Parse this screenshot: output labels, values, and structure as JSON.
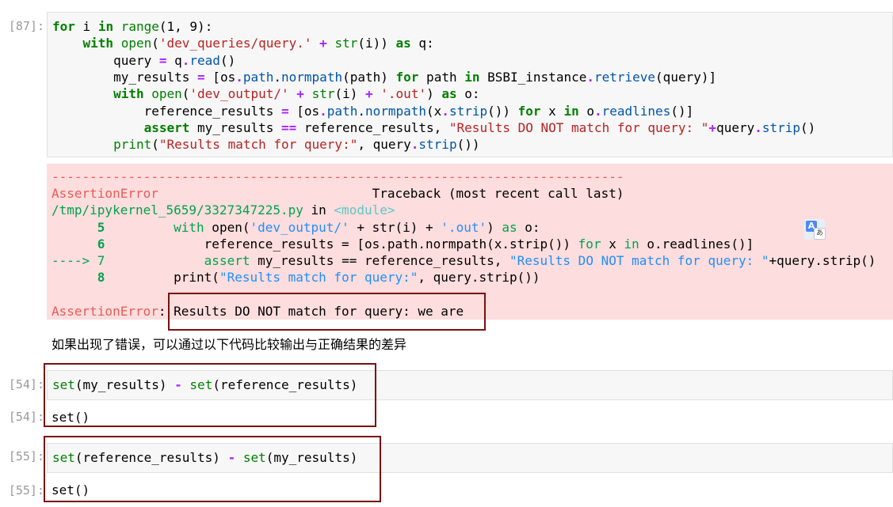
{
  "cells": [
    {
      "prompt": "[87]:",
      "code": [
        [
          {
            "t": "for",
            "c": "kw"
          },
          {
            "t": " i "
          },
          {
            "t": "in",
            "c": "kw"
          },
          {
            "t": " "
          },
          {
            "t": "range",
            "c": "fn"
          },
          {
            "t": "(1, 9):"
          }
        ],
        [
          {
            "t": "    "
          },
          {
            "t": "with",
            "c": "kw"
          },
          {
            "t": " "
          },
          {
            "t": "open",
            "c": "fn"
          },
          {
            "t": "("
          },
          {
            "t": "'dev_queries/query.'",
            "c": "str"
          },
          {
            "t": " "
          },
          {
            "t": "+",
            "c": "op"
          },
          {
            "t": " "
          },
          {
            "t": "str",
            "c": "fn"
          },
          {
            "t": "(i)) "
          },
          {
            "t": "as",
            "c": "kw"
          },
          {
            "t": " q:"
          }
        ],
        [
          {
            "t": "        query "
          },
          {
            "t": "=",
            "c": "op"
          },
          {
            "t": " q"
          },
          {
            "t": ".",
            "c": "op"
          },
          {
            "t": "read",
            "c": "attr"
          },
          {
            "t": "()"
          }
        ],
        [
          {
            "t": "        my_results "
          },
          {
            "t": "=",
            "c": "op"
          },
          {
            "t": " [os"
          },
          {
            "t": ".",
            "c": "op"
          },
          {
            "t": "path",
            "c": "attr"
          },
          {
            "t": "."
          },
          {
            "t": "normpath",
            "c": "attr"
          },
          {
            "t": "(path) "
          },
          {
            "t": "for",
            "c": "kw"
          },
          {
            "t": " path "
          },
          {
            "t": "in",
            "c": "kw"
          },
          {
            "t": " BSBI_instance"
          },
          {
            "t": ".",
            "c": "op"
          },
          {
            "t": "retrieve",
            "c": "attr"
          },
          {
            "t": "(query)]"
          }
        ],
        [
          {
            "t": "        "
          },
          {
            "t": "with",
            "c": "kw"
          },
          {
            "t": " "
          },
          {
            "t": "open",
            "c": "fn"
          },
          {
            "t": "("
          },
          {
            "t": "'dev_output/'",
            "c": "str"
          },
          {
            "t": " "
          },
          {
            "t": "+",
            "c": "op"
          },
          {
            "t": " "
          },
          {
            "t": "str",
            "c": "fn"
          },
          {
            "t": "(i) "
          },
          {
            "t": "+",
            "c": "op"
          },
          {
            "t": " "
          },
          {
            "t": "'.out'",
            "c": "str"
          },
          {
            "t": ") "
          },
          {
            "t": "as",
            "c": "kw"
          },
          {
            "t": " o:"
          }
        ],
        [
          {
            "t": "            reference_results "
          },
          {
            "t": "=",
            "c": "op"
          },
          {
            "t": " [os"
          },
          {
            "t": ".",
            "c": "op"
          },
          {
            "t": "path",
            "c": "attr"
          },
          {
            "t": "."
          },
          {
            "t": "normpath",
            "c": "attr"
          },
          {
            "t": "(x"
          },
          {
            "t": ".",
            "c": "op"
          },
          {
            "t": "strip",
            "c": "attr"
          },
          {
            "t": "()) "
          },
          {
            "t": "for",
            "c": "kw"
          },
          {
            "t": " x "
          },
          {
            "t": "in",
            "c": "kw"
          },
          {
            "t": " o"
          },
          {
            "t": ".",
            "c": "op"
          },
          {
            "t": "readlines",
            "c": "attr"
          },
          {
            "t": "()]"
          }
        ],
        [
          {
            "t": "            "
          },
          {
            "t": "assert",
            "c": "kw"
          },
          {
            "t": " my_results "
          },
          {
            "t": "==",
            "c": "op"
          },
          {
            "t": " reference_results, "
          },
          {
            "t": "\"Results DO NOT match for query: \"",
            "c": "str"
          },
          {
            "t": "+",
            "c": "op"
          },
          {
            "t": "query"
          },
          {
            "t": ".",
            "c": "op"
          },
          {
            "t": "strip",
            "c": "attr"
          },
          {
            "t": "()"
          }
        ],
        [
          {
            "t": "        "
          },
          {
            "t": "print",
            "c": "fn"
          },
          {
            "t": "("
          },
          {
            "t": "\"Results match for query:\"",
            "c": "str"
          },
          {
            "t": ", query"
          },
          {
            "t": ".",
            "c": "op"
          },
          {
            "t": "strip",
            "c": "attr"
          },
          {
            "t": "())"
          }
        ]
      ]
    },
    {
      "prompt": "[54]:",
      "code": [
        [
          {
            "t": "set",
            "c": "fn"
          },
          {
            "t": "(my_results) "
          },
          {
            "t": "-",
            "c": "op"
          },
          {
            "t": " "
          },
          {
            "t": "set",
            "c": "fn"
          },
          {
            "t": "(reference_results)"
          }
        ]
      ],
      "output_prompt": "[54]:",
      "output": "set()"
    },
    {
      "prompt": "[55]:",
      "code": [
        [
          {
            "t": "set",
            "c": "fn"
          },
          {
            "t": "(reference_results) "
          },
          {
            "t": "-",
            "c": "op"
          },
          {
            "t": " "
          },
          {
            "t": "set",
            "c": "fn"
          },
          {
            "t": "(my_results)"
          }
        ]
      ],
      "output_prompt": "[55]:",
      "output": "set()"
    }
  ],
  "traceback": [
    [
      {
        "t": "---------------------------------------------------------------------------",
        "c": "red"
      }
    ],
    [
      {
        "t": "AssertionError",
        "c": "red"
      },
      {
        "t": "                            Traceback (most recent call last)"
      }
    ],
    [
      {
        "t": "/tmp/ipykernel_5659/3327347225.py",
        "c": "grn"
      },
      {
        "t": " in "
      },
      {
        "t": "<module>",
        "c": "cyn"
      }
    ],
    [
      {
        "t": "      5",
        "c": "grnb"
      },
      {
        "t": "         "
      },
      {
        "t": "with",
        "c": "grn"
      },
      {
        "t": " open("
      },
      {
        "t": "'dev_output/'",
        "c": "blu"
      },
      {
        "t": " + str(i) + "
      },
      {
        "t": "'.out'",
        "c": "blu"
      },
      {
        "t": ") "
      },
      {
        "t": "as",
        "c": "grn"
      },
      {
        "t": " o:"
      }
    ],
    [
      {
        "t": "      6",
        "c": "grnb"
      },
      {
        "t": "             reference_results = [os.path.normpath(x.strip()) "
      },
      {
        "t": "for",
        "c": "grn"
      },
      {
        "t": " x "
      },
      {
        "t": "in",
        "c": "grn"
      },
      {
        "t": " o.readlines()]"
      }
    ],
    [
      {
        "t": "----> 7",
        "c": "grn"
      },
      {
        "t": "             "
      },
      {
        "t": "assert",
        "c": "grn"
      },
      {
        "t": " my_results == reference_results, "
      },
      {
        "t": "\"Results DO NOT match for query: \"",
        "c": "blu"
      },
      {
        "t": "+query.strip()"
      }
    ],
    [
      {
        "t": "      8",
        "c": "grnb"
      },
      {
        "t": "         print("
      },
      {
        "t": "\"Results match for query:\"",
        "c": "blu"
      },
      {
        "t": ", query.strip())"
      }
    ],
    [
      {
        "t": ""
      }
    ],
    [
      {
        "t": "AssertionError",
        "c": "red"
      },
      {
        "t": ": Results DO NOT match for query: we are"
      }
    ]
  ],
  "markdown": "如果出现了错误，可以通过以下代码比较输出与正确结果的差异",
  "translate_icon": {
    "a": "A",
    "b": "あ"
  }
}
